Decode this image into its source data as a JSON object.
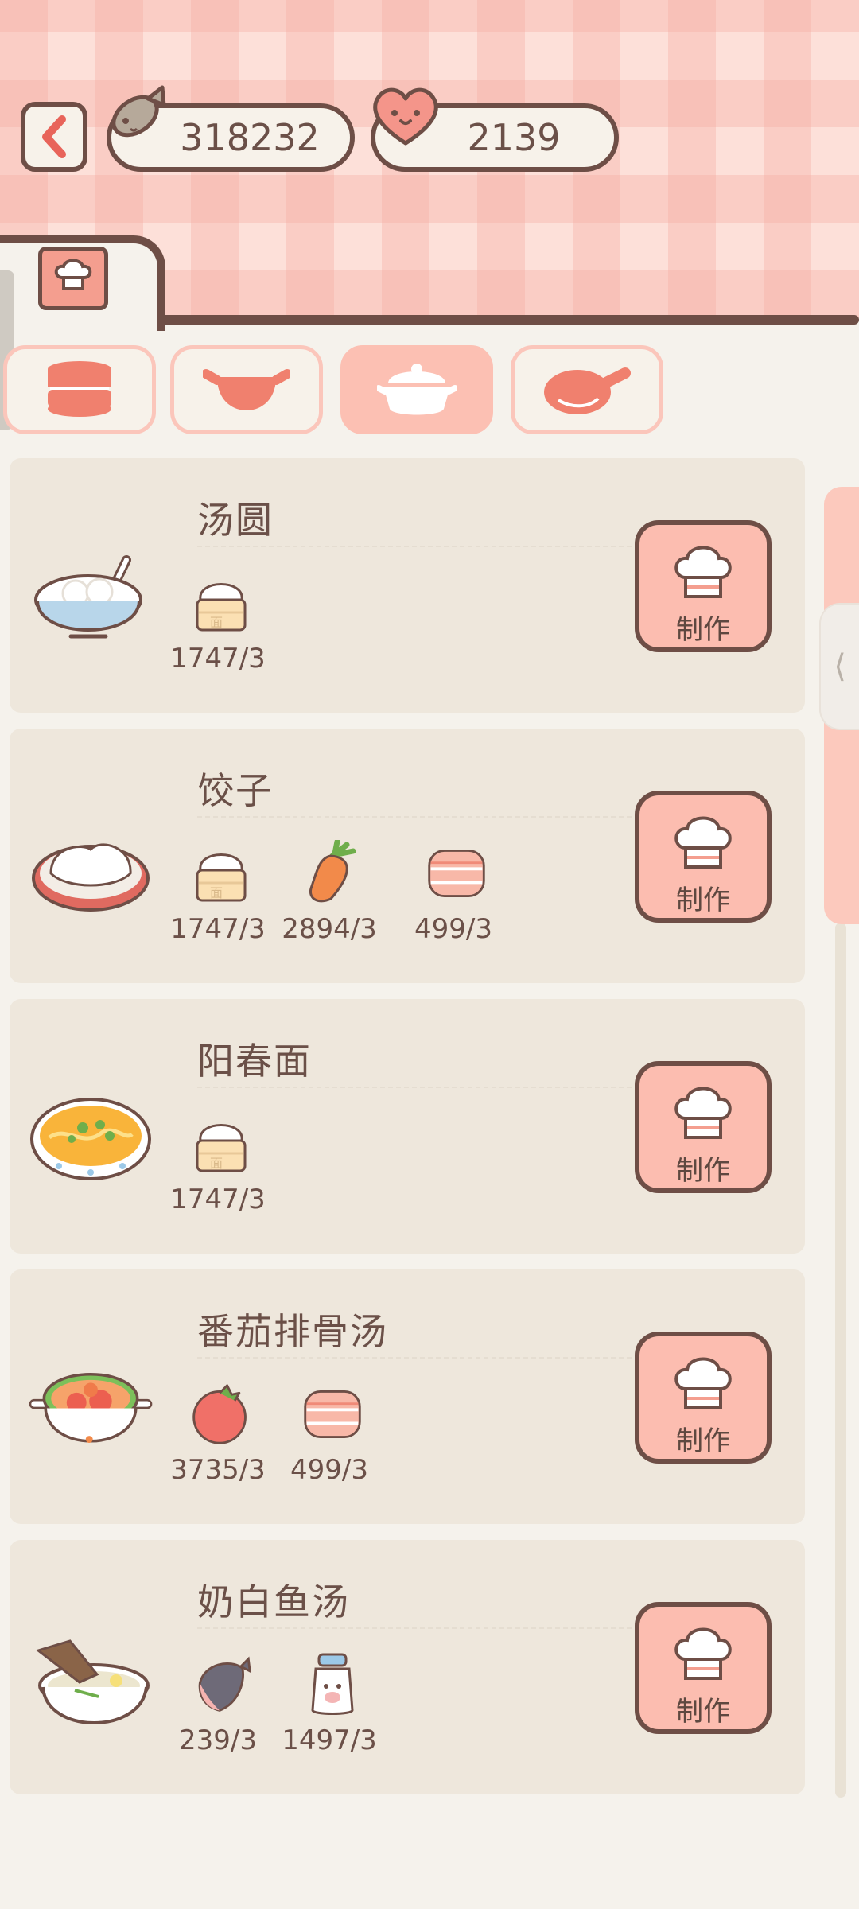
{
  "currency": {
    "coins": "318232",
    "hearts": "2139"
  },
  "tabs": {
    "main_icon": "chef-book-icon",
    "sub": [
      {
        "icon": "steamer-stack-icon",
        "active": false
      },
      {
        "icon": "wok-icon",
        "active": false
      },
      {
        "icon": "pot-icon",
        "active": true
      },
      {
        "icon": "frying-pan-icon",
        "active": false
      }
    ]
  },
  "recipes": [
    {
      "name": "汤圆",
      "dish_icon": "tangyuan-bowl-icon",
      "ingredients": [
        {
          "icon": "flour-icon",
          "count": "1747/3"
        }
      ],
      "button": "制作"
    },
    {
      "name": "饺子",
      "dish_icon": "dumpling-plate-icon",
      "ingredients": [
        {
          "icon": "flour-icon",
          "count": "1747/3"
        },
        {
          "icon": "carrot-icon",
          "count": "2894/3"
        },
        {
          "icon": "meat-icon",
          "count": "499/3"
        }
      ],
      "button": "制作"
    },
    {
      "name": "阳春面",
      "dish_icon": "noodle-bowl-icon",
      "ingredients": [
        {
          "icon": "flour-icon",
          "count": "1747/3"
        }
      ],
      "button": "制作"
    },
    {
      "name": "番茄排骨汤",
      "dish_icon": "tomato-soup-pot-icon",
      "ingredients": [
        {
          "icon": "tomato-icon",
          "count": "3735/3"
        },
        {
          "icon": "meat-icon",
          "count": "499/3"
        }
      ],
      "button": "制作"
    },
    {
      "name": "奶白鱼汤",
      "dish_icon": "fish-soup-bowl-icon",
      "ingredients": [
        {
          "icon": "fish-icon",
          "count": "239/3"
        },
        {
          "icon": "milk-bottle-icon",
          "count": "1497/3"
        }
      ],
      "button": "制作"
    }
  ]
}
